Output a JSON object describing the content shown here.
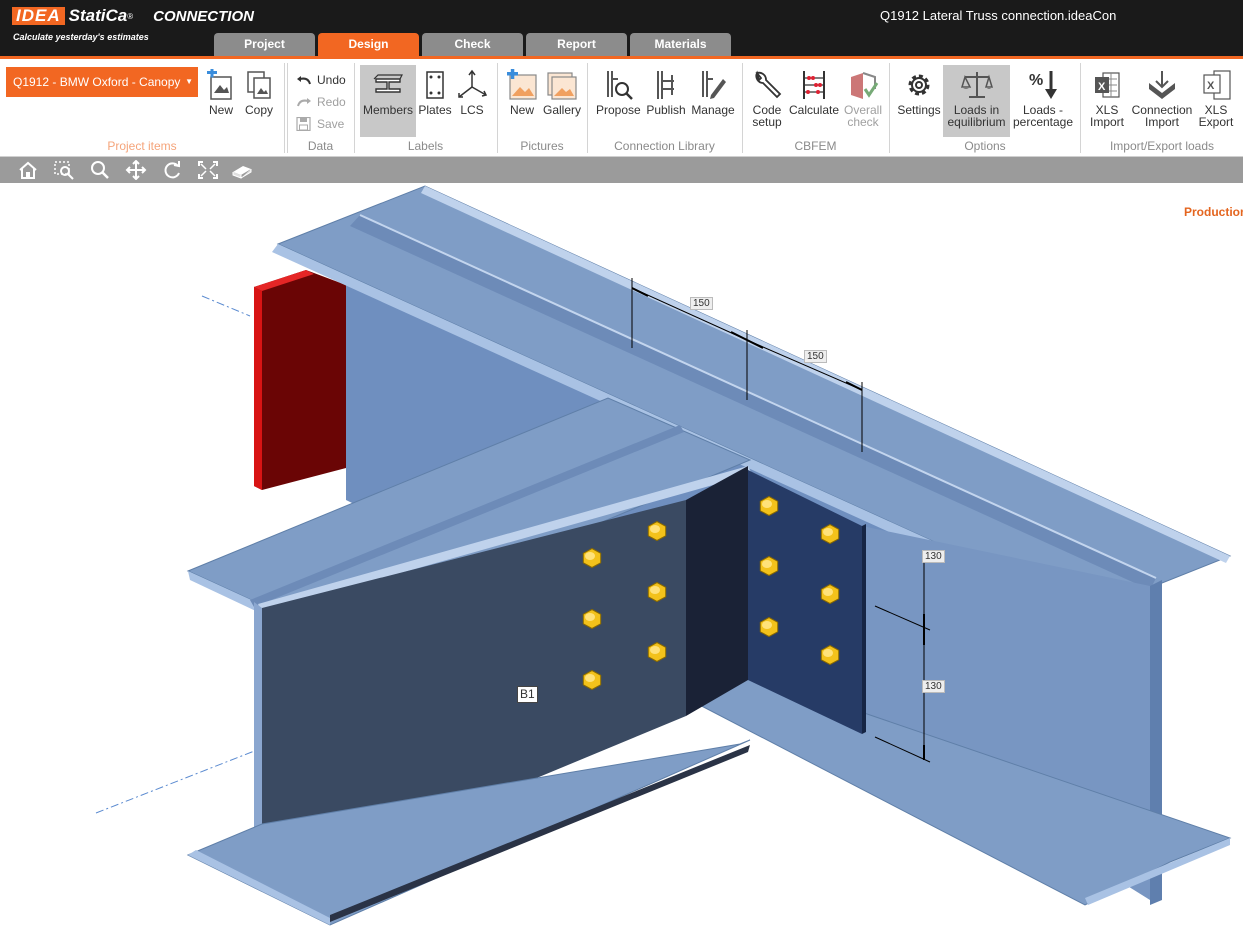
{
  "app": {
    "brand_box": "IDEA",
    "brand_name": "StatiCa",
    "brand_reg": "®",
    "product": "CONNECTION",
    "tagline": "Calculate yesterday's estimates",
    "window_title": "Q1912 Lateral Truss connection.ideaCon"
  },
  "tabs": [
    {
      "label": "Project",
      "active": false
    },
    {
      "label": "Design",
      "active": true
    },
    {
      "label": "Check",
      "active": false
    },
    {
      "label": "Report",
      "active": false
    },
    {
      "label": "Materials",
      "active": false
    }
  ],
  "ribbon": {
    "project_items": {
      "selected_item": "Q1912 - BMW Oxford - Canopy",
      "new_label": "New",
      "copy_label": "Copy",
      "group_label": "Project items"
    },
    "data": {
      "undo_label": "Undo",
      "redo_label": "Redo",
      "save_label": "Save",
      "group_label": "Data"
    },
    "labels": {
      "members_label": "Members",
      "plates_label": "Plates",
      "lcs_label": "LCS",
      "group_label": "Labels"
    },
    "pictures": {
      "new_label": "New",
      "gallery_label": "Gallery",
      "group_label": "Pictures"
    },
    "connection_library": {
      "propose_label": "Propose",
      "publish_label": "Publish",
      "manage_label": "Manage",
      "group_label": "Connection Library"
    },
    "cbfem": {
      "code_setup_line1": "Code",
      "code_setup_line2": "setup",
      "calculate_label": "Calculate",
      "overall_check_line1": "Overall",
      "overall_check_line2": "check",
      "group_label": "CBFEM"
    },
    "options": {
      "settings_label": "Settings",
      "loads_eq_line1": "Loads in",
      "loads_eq_line2": "equilibrium",
      "loads_pct_line1": "Loads -",
      "loads_pct_line2": "percentage",
      "group_label": "Options"
    },
    "import_export": {
      "xls_import_line1": "XLS",
      "xls_import_line2": "Import",
      "conn_import_line1": "Connection",
      "conn_import_line2": "Import",
      "xls_export_line1": "XLS",
      "xls_export_line2": "Export",
      "group_label": "Import/Export loads"
    }
  },
  "viewbar_icons": [
    "home-icon",
    "zoom-window-icon",
    "zoom-icon",
    "pan-icon",
    "rotate-icon",
    "fit-view-icon",
    "eraser-icon"
  ],
  "scene": {
    "production_label": "Production",
    "member_label": "B1",
    "dims": {
      "top1": "150",
      "top2": "150",
      "side1": "130",
      "side2": "130"
    }
  },
  "colors": {
    "accent": "#f26722",
    "steel": "#7f9dc6",
    "bolt": "#f3c21b",
    "plate_red": "#cc1010"
  }
}
